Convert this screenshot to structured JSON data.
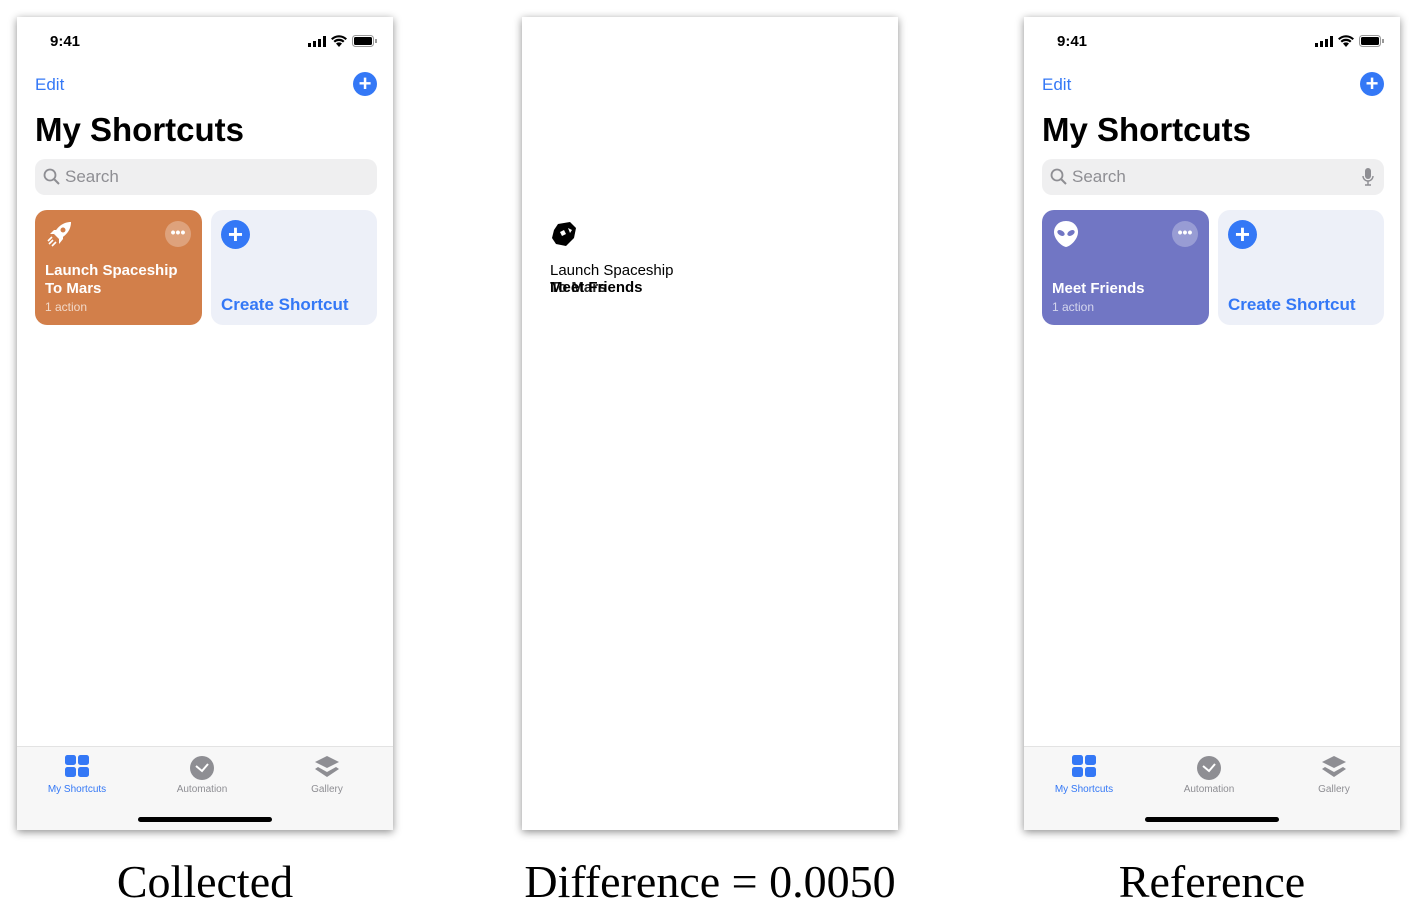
{
  "captions": {
    "left": "Collected",
    "middle": "Difference = 0.0050",
    "right": "Reference"
  },
  "phones": [
    {
      "id": "collected",
      "time": "9:41",
      "edit": "Edit",
      "title": "My Shortcuts",
      "search_placeholder": "Search",
      "mic": false,
      "card": {
        "name": "Launch Spaceship To Mars",
        "actions": "1 action",
        "color": "#d27f4a",
        "icon": "rocket-icon"
      },
      "create": "Create Shortcut",
      "tabs": [
        {
          "label": "My Shortcuts",
          "icon": "grid-icon",
          "active": true
        },
        {
          "label": "Automation",
          "icon": "automation-check-icon"
        },
        {
          "label": "Gallery",
          "icon": "layers-icon"
        }
      ]
    },
    {
      "id": "reference",
      "time": "9:41",
      "edit": "Edit",
      "title": "My Shortcuts",
      "search_placeholder": "Search",
      "mic": true,
      "card": {
        "name": "Meet Friends",
        "actions": "1 action",
        "color": "#7176c4",
        "icon": "alien-icon"
      },
      "create": "Create Shortcut",
      "tabs": [
        {
          "label": "My Shortcuts",
          "icon": "grid-icon",
          "active": true
        },
        {
          "label": "Automation",
          "icon": "automation-check-icon"
        },
        {
          "label": "Gallery",
          "icon": "layers-icon"
        }
      ]
    }
  ],
  "difference": {
    "line1": "Launch Spaceship",
    "line2a": "To Mars",
    "line2b": "Meet Friends"
  },
  "colors": {
    "accent": "#3478f6",
    "inactive": "#8e8e93"
  }
}
